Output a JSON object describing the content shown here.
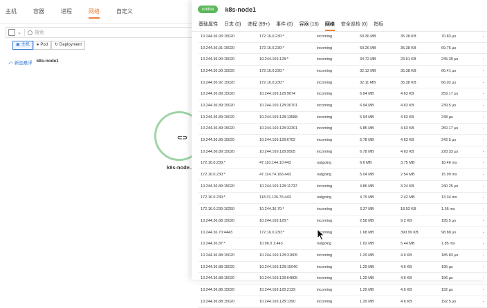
{
  "topnav": {
    "items": [
      "主机",
      "容器",
      "进程",
      "网络",
      "自定义"
    ],
    "active_index": 3
  },
  "filter": {
    "placeholder": "搜索"
  },
  "view_buttons": [
    {
      "label": "主机",
      "icon": "host-icon",
      "active": true
    },
    {
      "label": "Pod",
      "icon": "pod-icon",
      "active": false
    },
    {
      "label": "Deployment",
      "icon": "deployment-icon",
      "active": false
    }
  ],
  "breadcrumb": {
    "back": "新回悬浮",
    "current": "k8s-node1"
  },
  "graph": {
    "node_label": "k8s-node...",
    "node_icon": "link-icon"
  },
  "panel": {
    "status": "online",
    "title": "k8s-node1",
    "tabs": [
      "基础属性",
      "日志 (0)",
      "进程 (99+)",
      "事件 (0)",
      "容器 (16)",
      "网络",
      "安全巡检 (0)",
      "指标"
    ],
    "active_tab": 5,
    "rows": [
      [
        "10.244.36.93:15020",
        "172.16.0.230:*",
        "incoming",
        "50.36 MB",
        "35.38 KB",
        "70.83 μs",
        "-"
      ],
      [
        "10.244.36.91:15020",
        "172.16.0.230:*",
        "incoming",
        "50.26 MB",
        "35.38 KB",
        "69.75 μs",
        "-"
      ],
      [
        "10.244.36.90:15020",
        "10.244.169.128:*",
        "incoming",
        "34.72 MB",
        "23.61 KB",
        "245.39 μs",
        "-"
      ],
      [
        "10.244.36.90:15020",
        "172.16.0.230:*",
        "incoming",
        "32.12 MB",
        "35.38 KB",
        "66.41 μs",
        "-"
      ],
      [
        "10.244.36.92:15020",
        "172.16.0.230:*",
        "incoming",
        "32.11 MB",
        "35.38 KB",
        "66.02 μs",
        "-"
      ],
      [
        "10.244.36.89:15020",
        "10.244.169.128:9674",
        "incoming",
        "6.94 MB",
        "4.63 KB",
        "259.17 μs",
        "-"
      ],
      [
        "10.244.36.89:15020",
        "10.244.169.128:30701",
        "incoming",
        "6.94 MB",
        "4.63 KB",
        "239.5 μs",
        "-"
      ],
      [
        "10.244.36.89:15020",
        "10.244.169.128:13588",
        "incoming",
        "6.94 MB",
        "4.63 KB",
        "248 μs",
        "-"
      ],
      [
        "10.244.36.89:15020",
        "10.244.169.128:32301",
        "incoming",
        "6.85 MB",
        "4.63 KB",
        "250.17 μs",
        "-"
      ],
      [
        "10.244.36.89:15020",
        "10.244.169.128:6702",
        "incoming",
        "6.78 MB",
        "4.63 KB",
        "242.5 μs",
        "-"
      ],
      [
        "10.244.36.89:15020",
        "10.244.169.128:9505",
        "incoming",
        "6.78 MB",
        "4.63 KB",
        "228.33 μs",
        "-"
      ],
      [
        "172.16.0.230:*",
        "47.110.144.10:443",
        "outgoing",
        "6.6 MB",
        "3.75 MB",
        "18.46 ms",
        "-"
      ],
      [
        "172.16.0.230:*",
        "47.114.74.166:443",
        "outgoing",
        "5.04 MB",
        "2.54 MB",
        "15.99 ms",
        "-"
      ],
      [
        "10.244.36.89:15020",
        "10.244.169.128:11737",
        "incoming",
        "4.86 MB",
        "3.24 KB",
        "240.25 μs",
        "-"
      ],
      [
        "172.16.0.230:*",
        "118.31.126.76:443",
        "outgoing",
        "4.79 MB",
        "2.42 MB",
        "13.34 ms",
        "-"
      ],
      [
        "172.16.0.230:10250",
        "10.244.36.70:*",
        "incoming",
        "3.37 MB",
        "18.93 KB",
        "1.56 ms",
        "-"
      ],
      [
        "10.244.36.88:15020",
        "10.244.169.128:*",
        "incoming",
        "2.58 MB",
        "9.2 KB",
        "195.5 μs",
        "-"
      ],
      [
        "10.244.36.70:4443",
        "172.16.0.230:*",
        "incoming",
        "1.68 MB",
        "390.99 KB",
        "98.88 μs",
        "-"
      ],
      [
        "10.244.36.87:*",
        "10.96.0.1:443",
        "outgoing",
        "1.62 MB",
        "5.44 MB",
        "1.85 ms",
        "-"
      ],
      [
        "10.244.36.88:15020",
        "10.244.169.128:31805",
        "incoming",
        "1.29 MB",
        "4.6 KB",
        "185.83 μs",
        "-"
      ],
      [
        "10.244.36.88:15020",
        "10.244.169.128:15046",
        "incoming",
        "1.29 MB",
        "4.6 KB",
        "195 μs",
        "-"
      ],
      [
        "10.244.36.88:15020",
        "10.244.169.128:64805",
        "incoming",
        "1.29 MB",
        "4.6 KB",
        "196 μs",
        "-"
      ],
      [
        "10.244.36.88:15020",
        "10.244.169.128:2129",
        "incoming",
        "1.29 MB",
        "4.6 KB",
        "192 μs",
        "-"
      ],
      [
        "10.244.36.88:15020",
        "10.244.169.128:1390",
        "incoming",
        "1.29 MB",
        "4.6 KB",
        "192.5 μs",
        "-"
      ]
    ]
  },
  "colors": {
    "accent": "#e8803a",
    "online": "#5cb85c",
    "link": "#3a7bd5",
    "node_ring": "#9fd3a8"
  }
}
